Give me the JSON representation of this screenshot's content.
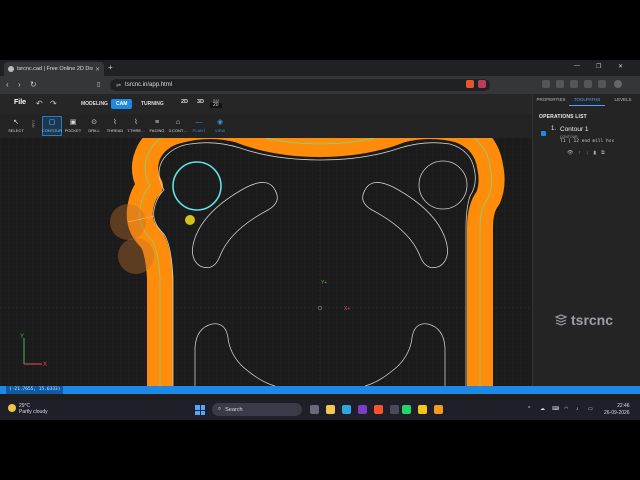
{
  "browser": {
    "tab_title": "tsrcnc.cad | Free Online 2D Dra…",
    "tab_close": "✕",
    "new_tab": "+",
    "url": "tsrcnc.in/app.html",
    "win_min": "—",
    "win_max": "❐",
    "win_close": "✕"
  },
  "app": {
    "file_menu": "File",
    "modes": [
      {
        "label": "MODELING"
      },
      {
        "label": "CAM"
      },
      {
        "label": "TURNING"
      }
    ],
    "view_2d": "2D",
    "view_3d": "3D",
    "sm_label": "SM",
    "sm_value": "20",
    "tools": [
      {
        "label": "SELECT",
        "icon": "↖"
      },
      {
        "label": "CONTOUR",
        "icon": "▢"
      },
      {
        "label": "POCKET",
        "icon": "▣"
      },
      {
        "label": "DRILL",
        "icon": "⊙"
      },
      {
        "label": "THREAD",
        "icon": "⌇"
      },
      {
        "label": "T.THRE…",
        "icon": "⌇"
      },
      {
        "label": "FACING",
        "icon": "≡"
      },
      {
        "label": "3.CONT…",
        "icon": "⌂"
      },
      {
        "label": "PLANT",
        "icon": "—"
      },
      {
        "label": "VIEW",
        "icon": "◉"
      }
    ],
    "cam_label": "CAM",
    "axis_y": "Y",
    "axis_x": "X",
    "origin_y": "Y+",
    "origin_x": "X+",
    "coords": "(-21.7655, 15.6333)"
  },
  "panel": {
    "tabs": [
      {
        "label": "PROPERTIES"
      },
      {
        "label": "TOOLPATHS"
      },
      {
        "label": "LEVELS"
      }
    ],
    "ops_header": "OPERATIONS LIST",
    "operation": {
      "number": "1.",
      "name": "Contour 1",
      "type": "CONTOUR",
      "tool": "T1 | 12 end mill hss",
      "actions": [
        "👁",
        "↑",
        "↓",
        "▮",
        "⧉"
      ]
    },
    "brand": "tsrcnc"
  },
  "taskbar": {
    "temp": "29°C",
    "weather": "Partly cloudy",
    "search": "Search",
    "time": "22:46",
    "date": "26-09-2026"
  },
  "colors": {
    "accent": "#1e88e5",
    "toolpath": "#ff8c0a",
    "tool_circle": "#62e0e8"
  }
}
